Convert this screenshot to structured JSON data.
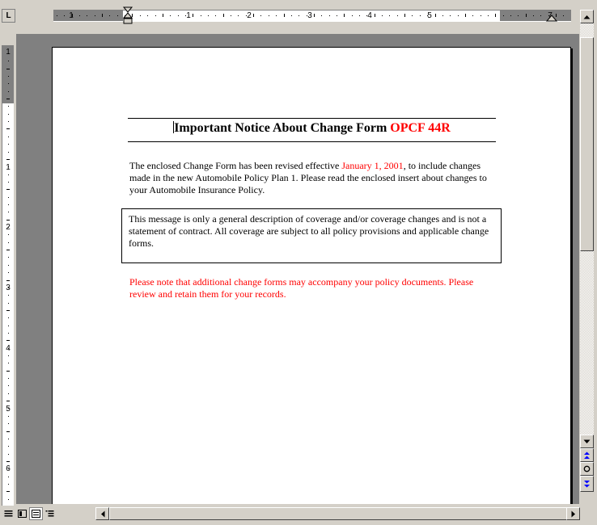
{
  "ruler": {
    "tab_selector_label": "L",
    "h_numbers": [
      "1",
      "1",
      "2",
      "3",
      "4",
      "5",
      "7"
    ],
    "v_numbers": [
      "1",
      "1",
      "2",
      "3",
      "4",
      "5",
      "6"
    ]
  },
  "document": {
    "heading_text": "Important Notice About Change Form ",
    "heading_red": "OPCF 44R",
    "para1_before": "The enclosed Change Form has been revised effective ",
    "para1_date": "January 1, 2001",
    "para1_after": ", to include changes made in the new Automobile Policy Plan 1.  Please read the enclosed insert about changes to your Automobile Insurance Policy.",
    "notice_box": "This message is only a general description of coverage and/or coverage changes and is not a statement of contract.  All coverage are subject to all policy provisions and applicable change forms.",
    "para3": "Please note that additional change forms may accompany your policy documents.  Please review and retain them for your records."
  },
  "icons": {
    "scroll_up": "up-arrow-icon",
    "scroll_down": "down-arrow-icon",
    "prev_page": "double-up-arrow-icon",
    "next_page": "double-down-arrow-icon",
    "select_browse": "circle-icon",
    "scroll_left": "left-arrow-icon",
    "scroll_right": "right-arrow-icon"
  },
  "colors": {
    "accent_red": "#ff0000",
    "browse_blue": "#0000ff"
  }
}
